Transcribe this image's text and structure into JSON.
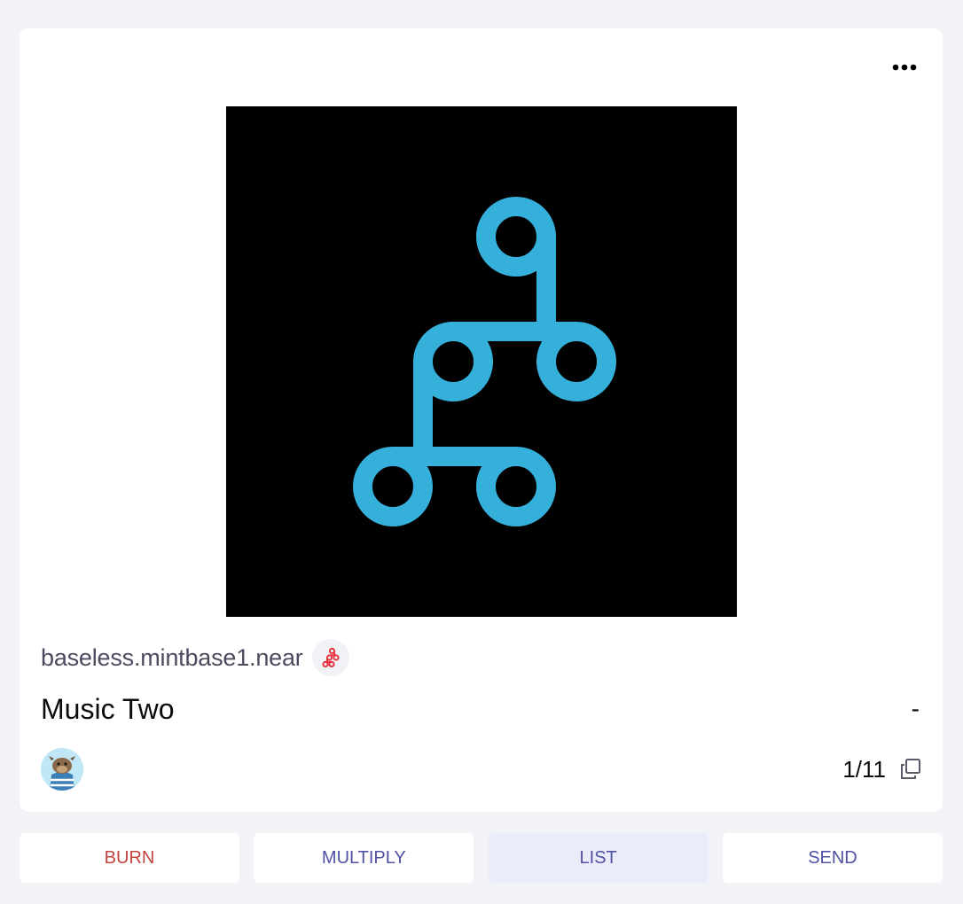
{
  "card": {
    "more_icon": "more-horizontal-icon",
    "artwork_icon": "mintbase-logo",
    "store_name": "baseless.mintbase1.near",
    "store_badge_icon": "mintbase-logo-icon",
    "title": "Music Two",
    "price": "-",
    "owner_avatar": "owner-avatar",
    "copies": "1/11",
    "copy_icon": "copy-icon"
  },
  "actions": {
    "burn": "BURN",
    "multiply": "MULTIPLY",
    "list": "LIST",
    "send": "SEND"
  },
  "colors": {
    "page_background": "#f2f3f7",
    "logo_blue": "#35b0db",
    "burn_red": "#c4433f",
    "action_purple": "#4f52a3",
    "list_highlight": "#ebecf9"
  }
}
